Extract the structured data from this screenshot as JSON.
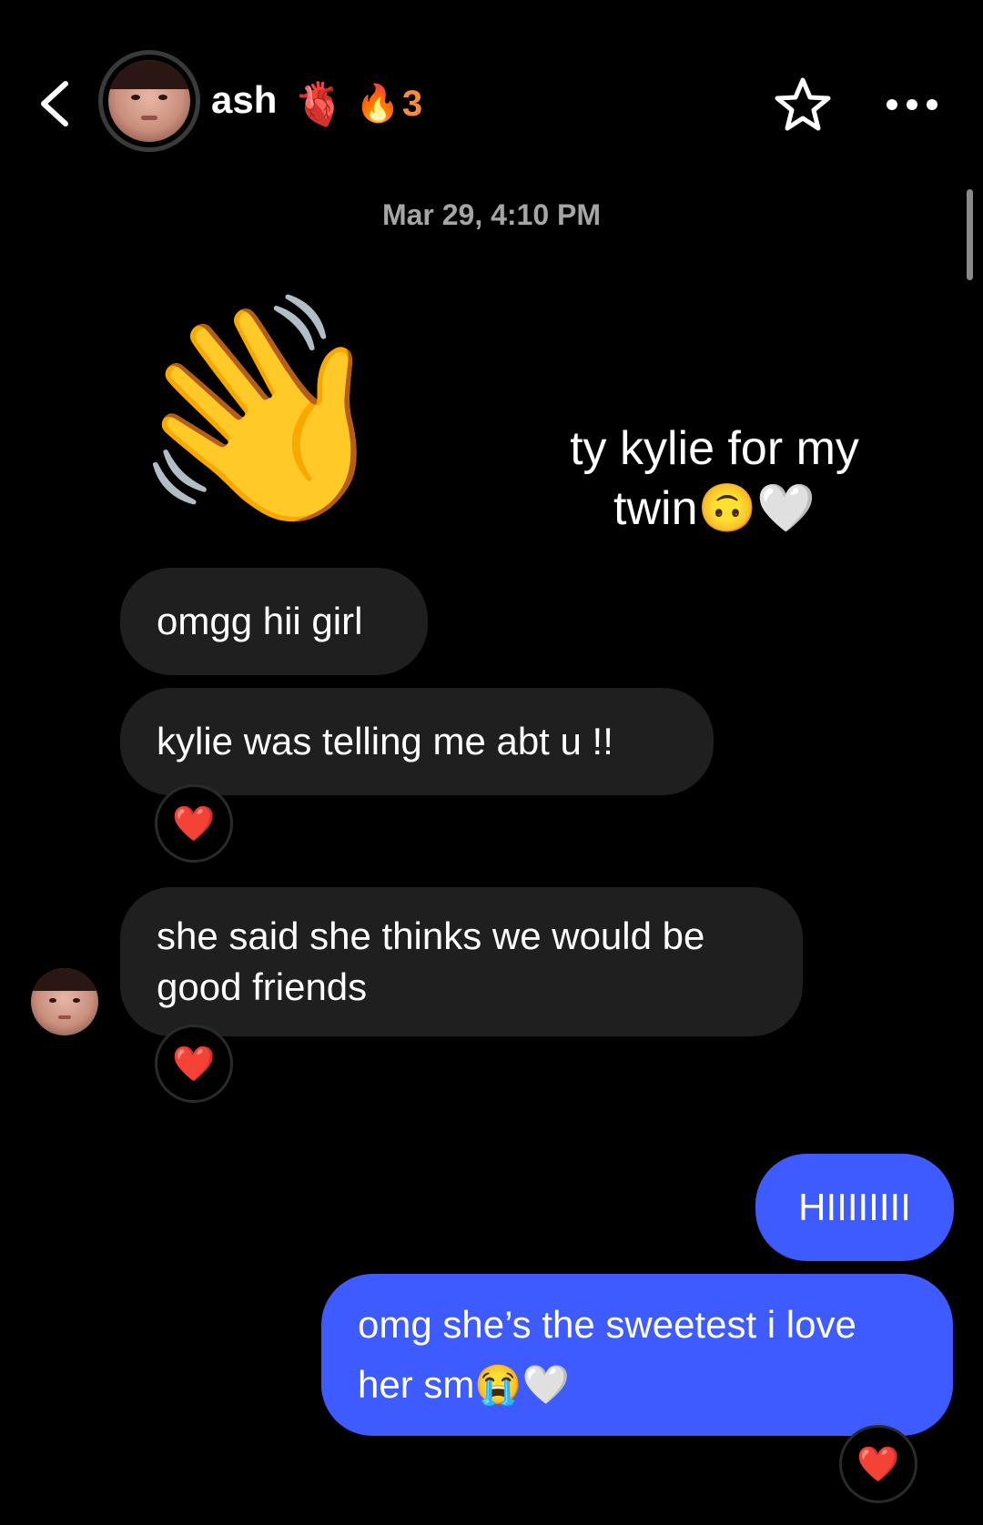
{
  "header": {
    "contact_name": "ash",
    "name_emoji": "🫀",
    "streak_emoji": "🔥",
    "streak_count": "3"
  },
  "timestamp": "Mar 29, 4:10 PM",
  "sticker_emoji": "👋",
  "caption": "ty kylie for my twin🙃🤍",
  "messages": [
    {
      "direction": "incoming",
      "text": "omgg hii girl",
      "reaction": ""
    },
    {
      "direction": "incoming",
      "text": "kylie was telling me abt u !!",
      "reaction": "❤️"
    },
    {
      "direction": "incoming",
      "text": "she said she thinks we would be good friends",
      "reaction": "❤️"
    },
    {
      "direction": "outgoing",
      "text": "HIIIIIIII",
      "reaction": ""
    },
    {
      "direction": "outgoing",
      "text": "omg she’s the sweetest i love her sm😭🤍",
      "reaction": "❤️"
    }
  ],
  "colors": {
    "background": "#000000",
    "incoming_bubble": "#1f1f1f",
    "outgoing_bubble": "#3d5bff",
    "streak": "#ff8a3d",
    "timestamp": "#a5a5a5"
  },
  "icons": {
    "back": "chevron-left-icon",
    "favorite": "star-outline-icon",
    "more": "more-horizontal-icon"
  }
}
